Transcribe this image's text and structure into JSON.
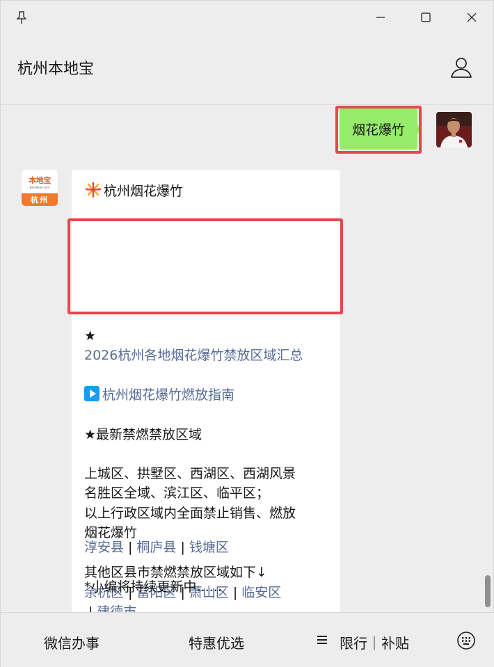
{
  "header": {
    "title": "杭州本地宝"
  },
  "chat": {
    "outgoing": {
      "text": "烟花爆竹"
    },
    "incoming": {
      "title": "杭州烟花爆竹",
      "star1": "★",
      "link1": "2026杭州各地烟花爆竹禁放区域汇总",
      "link2": "杭州烟花爆竹燃放指南",
      "section": "★最新禁燃禁放区域",
      "para1": [
        "上城区、拱墅区、西湖区、西湖风景",
        "名胜区全域、滨江区、临平区；",
        "以上行政区域内全面禁止销售、燃放",
        "烟花爆竹"
      ],
      "others_intro": "其他区县市禁燃禁放区域如下↓",
      "districts_row1": [
        "余杭区",
        "富阳区",
        "萧山区",
        "临安区"
      ],
      "districts_row2": [
        "建德市"
      ],
      "districts_row3": [
        "淳安县",
        "桐庐县",
        "钱塘区"
      ],
      "separator": "|",
      "footer": "*小编将持续更新中......"
    },
    "bot_avatar": {
      "logo": "本地宝",
      "sub": "Bendibao.com",
      "city": "杭州"
    }
  },
  "menu": [
    {
      "label": "微信办事"
    },
    {
      "label": "特惠优选"
    },
    {
      "label": "限行｜补贴"
    }
  ],
  "colors": {
    "outgoing_bubble": "#95ec69",
    "link": "#576b95",
    "highlight": "#e5484d"
  }
}
